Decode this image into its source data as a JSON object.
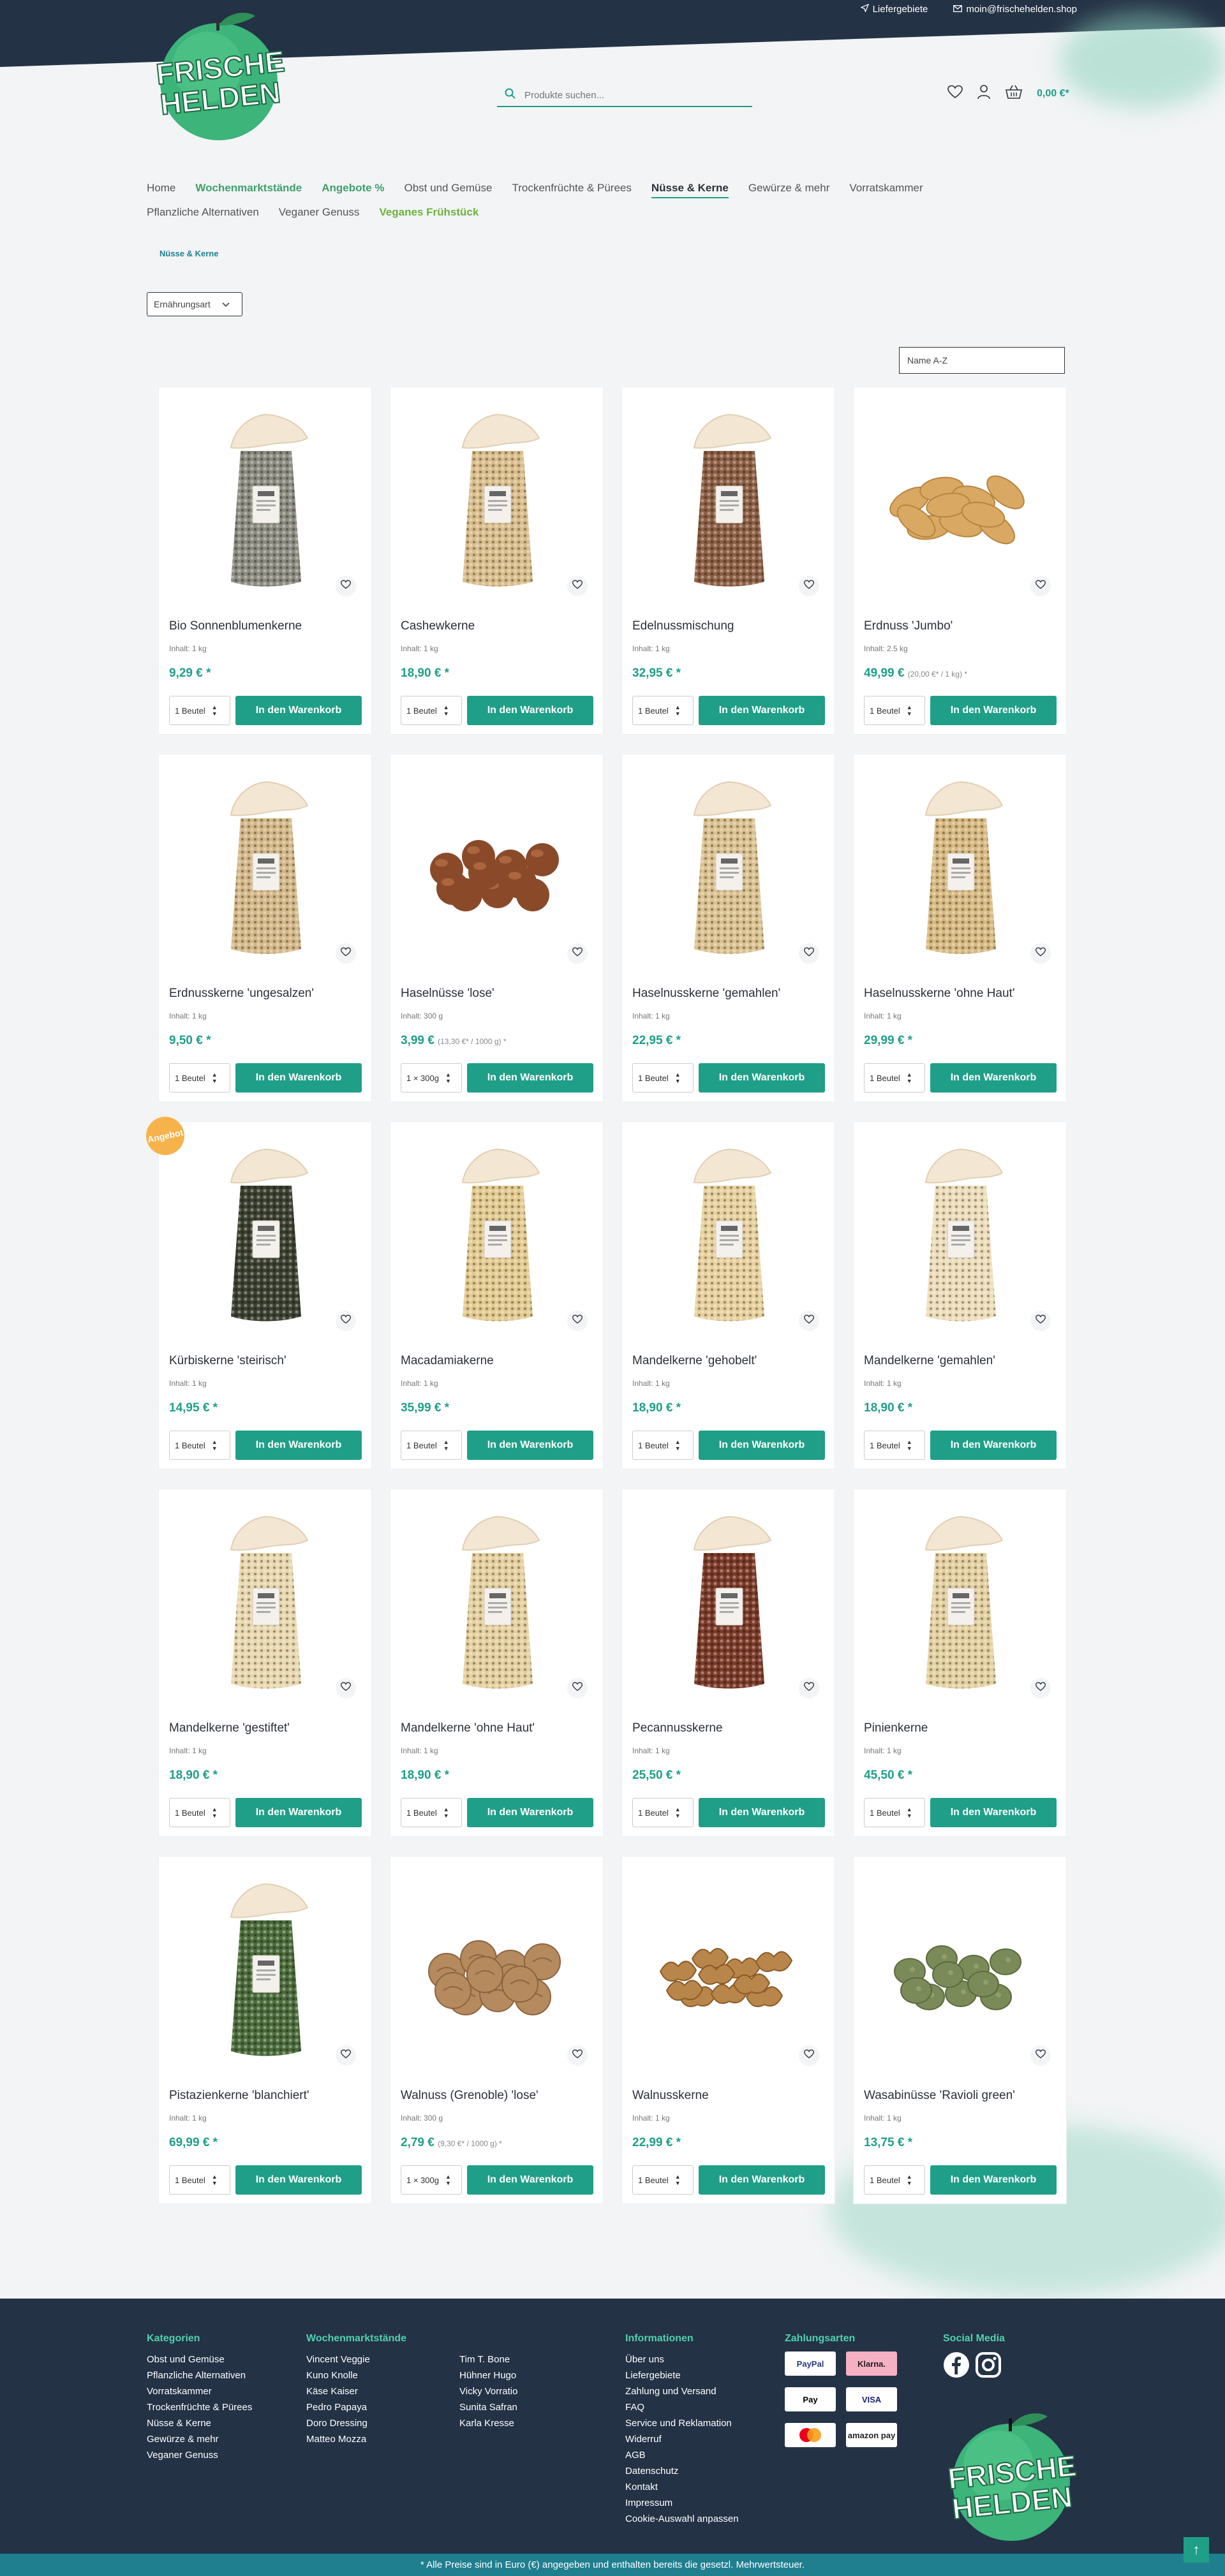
{
  "header": {
    "top_links": [
      "Liefergebiete",
      "moin@frischehelden.shop"
    ],
    "logo_text_line1": "FRISCHE",
    "logo_text_line2": "HELDEN",
    "search_placeholder": "Produkte suchen...",
    "cart_total": "0,00 €*",
    "icons": [
      "heart-icon",
      "user-icon",
      "basket-icon"
    ]
  },
  "nav": {
    "items": [
      {
        "label": "Home",
        "style": "normal"
      },
      {
        "label": "Wochenmarktstände",
        "style": "green"
      },
      {
        "label": "Angebote %",
        "style": "green"
      },
      {
        "label": "Obst und Gemüse",
        "style": "normal"
      },
      {
        "label": "Trockenfrüchte & Pürees",
        "style": "normal"
      },
      {
        "label": "Nüsse & Kerne",
        "style": "active"
      },
      {
        "label": "Gewürze & mehr",
        "style": "normal"
      },
      {
        "label": "Vorratskammer",
        "style": "normal"
      },
      {
        "label": "Pflanzliche Alternativen",
        "style": "normal"
      },
      {
        "label": "Veganer Genuss",
        "style": "normal"
      },
      {
        "label": "Veganes Frühstück",
        "style": "lime"
      }
    ]
  },
  "breadcrumb": "Nüsse & Kerne",
  "filter_label": "Ernährungsart",
  "sort_label": "Name A-Z",
  "buy_label": "In den Warenkorb",
  "badge_label": "Angebot",
  "products": [
    {
      "name": "Bio Sonnenblumenkerne",
      "content": "Inhalt: 1 kg",
      "price": "9,29 € *",
      "unit_price": "",
      "qty": "1 Beutel",
      "img": "bag",
      "fill": "#8a8a80",
      "badge": false
    },
    {
      "name": "Cashewkerne",
      "content": "Inhalt: 1 kg",
      "price": "18,90 € *",
      "unit_price": "",
      "qty": "1 Beutel",
      "img": "bag",
      "fill": "#d8bc8a",
      "badge": false
    },
    {
      "name": "Edelnussmischung",
      "content": "Inhalt: 1 kg",
      "price": "32,95 € *",
      "unit_price": "",
      "qty": "1 Beutel",
      "img": "bag",
      "fill": "#8b5e43",
      "badge": false
    },
    {
      "name": "Erdnuss 'Jumbo'",
      "content": "Inhalt: 2.5 kg",
      "price": "49,99 €",
      "unit_price": "(20,00 €* / 1 kg) *",
      "qty": "1 Beutel",
      "img": "peanuts",
      "fill": "#d9a863",
      "badge": false
    },
    {
      "name": "Erdnusskerne 'ungesalzen'",
      "content": "Inhalt: 1 kg",
      "price": "9,50 € *",
      "unit_price": "",
      "qty": "1 Beutel",
      "img": "bag",
      "fill": "#d3b787",
      "badge": false
    },
    {
      "name": "Haselnüsse 'lose'",
      "content": "Inhalt: 300 g",
      "price": "3,99 €",
      "unit_price": "(13,30 €* / 1000 g) *",
      "qty": "1 × 300g",
      "img": "hazelnuts",
      "fill": "#8a4a2a",
      "badge": false
    },
    {
      "name": "Haselnusskerne 'gemahlen'",
      "content": "Inhalt: 1 kg",
      "price": "22,95 € *",
      "unit_price": "",
      "qty": "1 Beutel",
      "img": "bag",
      "fill": "#d9c08e",
      "badge": false
    },
    {
      "name": "Haselnusskerne 'ohne Haut'",
      "content": "Inhalt: 1 kg",
      "price": "29,99 € *",
      "unit_price": "",
      "qty": "1 Beutel",
      "img": "bag",
      "fill": "#d6b880",
      "badge": false
    },
    {
      "name": "Kürbiskerne 'steirisch'",
      "content": "Inhalt: 1 kg",
      "price": "14,95 € *",
      "unit_price": "",
      "qty": "1 Beutel",
      "img": "bag",
      "fill": "#3b4030",
      "badge": true
    },
    {
      "name": "Macadamiakerne",
      "content": "Inhalt: 1 kg",
      "price": "35,99 € *",
      "unit_price": "",
      "qty": "1 Beutel",
      "img": "bag",
      "fill": "#e2c98f",
      "badge": false
    },
    {
      "name": "Mandelkerne 'gehobelt'",
      "content": "Inhalt: 1 kg",
      "price": "18,90 € *",
      "unit_price": "",
      "qty": "1 Beutel",
      "img": "bag",
      "fill": "#e6cf9c",
      "badge": false
    },
    {
      "name": "Mandelkerne 'gemahlen'",
      "content": "Inhalt: 1 kg",
      "price": "18,90 € *",
      "unit_price": "",
      "qty": "1 Beutel",
      "img": "bag",
      "fill": "#ecdcb8",
      "badge": false
    },
    {
      "name": "Mandelkerne 'gestiftet'",
      "content": "Inhalt: 1 kg",
      "price": "18,90 € *",
      "unit_price": "",
      "qty": "1 Beutel",
      "img": "bag",
      "fill": "#e8d7ae",
      "badge": false
    },
    {
      "name": "Mandelkerne 'ohne Haut'",
      "content": "Inhalt: 1 kg",
      "price": "18,90 € *",
      "unit_price": "",
      "qty": "1 Beutel",
      "img": "bag",
      "fill": "#e4cf9e",
      "badge": false
    },
    {
      "name": "Pecannusskerne",
      "content": "Inhalt: 1 kg",
      "price": "25,50 € *",
      "unit_price": "",
      "qty": "1 Beutel",
      "img": "bag",
      "fill": "#7a3a28",
      "badge": false
    },
    {
      "name": "Pinienkerne",
      "content": "Inhalt: 1 kg",
      "price": "45,50 € *",
      "unit_price": "",
      "qty": "1 Beutel",
      "img": "bag",
      "fill": "#e3cfa0",
      "badge": false
    },
    {
      "name": "Pistazienkerne 'blanchiert'",
      "content": "Inhalt: 1 kg",
      "price": "69,99 € *",
      "unit_price": "",
      "qty": "1 Beutel",
      "img": "bag",
      "fill": "#4a6a3a",
      "badge": false
    },
    {
      "name": "Walnuss (Grenoble) 'lose'",
      "content": "Inhalt: 300 g",
      "price": "2,79 €",
      "unit_price": "(9,30 €* / 1000 g) *",
      "qty": "1 × 300g",
      "img": "walnuts",
      "fill": "#b48a5e",
      "badge": false
    },
    {
      "name": "Walnusskerne",
      "content": "Inhalt: 1 kg",
      "price": "22,99 € *",
      "unit_price": "",
      "qty": "1 Beutel",
      "img": "kernels",
      "fill": "#b8864a",
      "badge": false
    },
    {
      "name": "Wasabinüsse 'Ravioli green'",
      "content": "Inhalt: 1 kg",
      "price": "13,75 € *",
      "unit_price": "",
      "qty": "1 Beutel",
      "img": "wasabi",
      "fill": "#7a8a58",
      "badge": false
    }
  ],
  "footer": {
    "categories_title": "Kategorien",
    "categories": [
      "Obst und Gemüse",
      "Pflanzliche Alternativen",
      "Vorratskammer",
      "Trockenfrüchte & Pürees",
      "Nüsse & Kerne",
      "Gewürze & mehr",
      "Veganer Genuss"
    ],
    "markets_title": "Wochenmarktstände",
    "markets_col1": [
      "Vincent Veggie",
      "Kuno Knolle",
      "Käse Kaiser",
      "Pedro Papaya",
      "Doro Dressing",
      "Matteo Mozza"
    ],
    "markets_col2": [
      "Tim T. Bone",
      "Hühner Hugo",
      "Vicky Vorratio",
      "Sunita Safran",
      "Karla Kresse"
    ],
    "info_title": "Informationen",
    "info": [
      "Über uns",
      "Liefergebiete",
      "Zahlung und Versand",
      "FAQ",
      "Service und Reklamation",
      "Widerruf",
      "AGB",
      "Datenschutz",
      "Kontakt",
      "Impressum",
      "Cookie-Auswahl anpassen"
    ],
    "payment_title": "Zahlungsarten",
    "payments": [
      {
        "label": "PayPal",
        "bg": "#ffffff",
        "color": "#253b80"
      },
      {
        "label": "Klarna.",
        "bg": "#f6b0c4",
        "color": "#222222"
      },
      {
        "label": "Pay",
        "bg": "#ffffff",
        "color": "#000000"
      },
      {
        "label": "VISA",
        "bg": "#ffffff",
        "color": "#1a1f71"
      },
      {
        "label": "",
        "bg": "#ffffff",
        "color": "#eb001b"
      },
      {
        "label": "amazon pay",
        "bg": "#ffffff",
        "color": "#222222"
      }
    ],
    "social_title": "Social Media",
    "legal_note": "* Alle Preise sind in Euro (€) angegeben und enthalten bereits die gesetzl. Mehrwertsteuer."
  },
  "colors": {
    "accent": "#1f9f87",
    "dark": "#243245",
    "badge": "#f6b34b"
  }
}
